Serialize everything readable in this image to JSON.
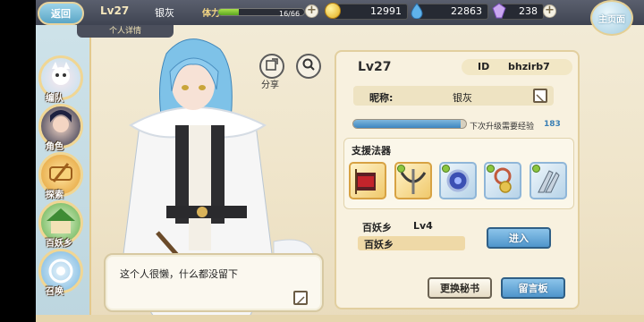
{
  "topbar": {
    "back_label": "返回",
    "home_label": "主页面",
    "level": "Lv27",
    "name": "银灰",
    "stamina_label": "体力",
    "stamina_text": "16/66",
    "stamina_fraction": 0.24,
    "gold": "12991",
    "gems": "22863",
    "crystals": "238"
  },
  "detail_tab": "个人详情",
  "nav": [
    {
      "label": "编队",
      "icon": "team-icon"
    },
    {
      "label": "角色",
      "icon": "character-icon"
    },
    {
      "label": "探索",
      "icon": "explore-icon"
    },
    {
      "label": "百妖乡",
      "icon": "village-icon"
    },
    {
      "label": "召唤",
      "icon": "summon-icon"
    }
  ],
  "share_label": "分享",
  "dialog_text": "这个人很懒，什么都没留下",
  "panel": {
    "level": "Lv27",
    "id_label": "ID",
    "id_value": "bhzirb7",
    "nick_label": "昵称:",
    "nick_value": "银灰",
    "exp_label": "下次升级需要经验",
    "exp_value": "183",
    "exp_fraction": 0.95,
    "support_title": "支援法器",
    "town_label": "百妖乡",
    "town_level": "Lv4",
    "town_name": "百妖乡",
    "enter_button": "进入",
    "change_secretary_button": "更换秘书",
    "message_board_button": "留言板"
  },
  "colors": {
    "accent_blue": "#4f95cb",
    "gold_border": "#d7a243",
    "panel_bg": "#f8f1df"
  }
}
